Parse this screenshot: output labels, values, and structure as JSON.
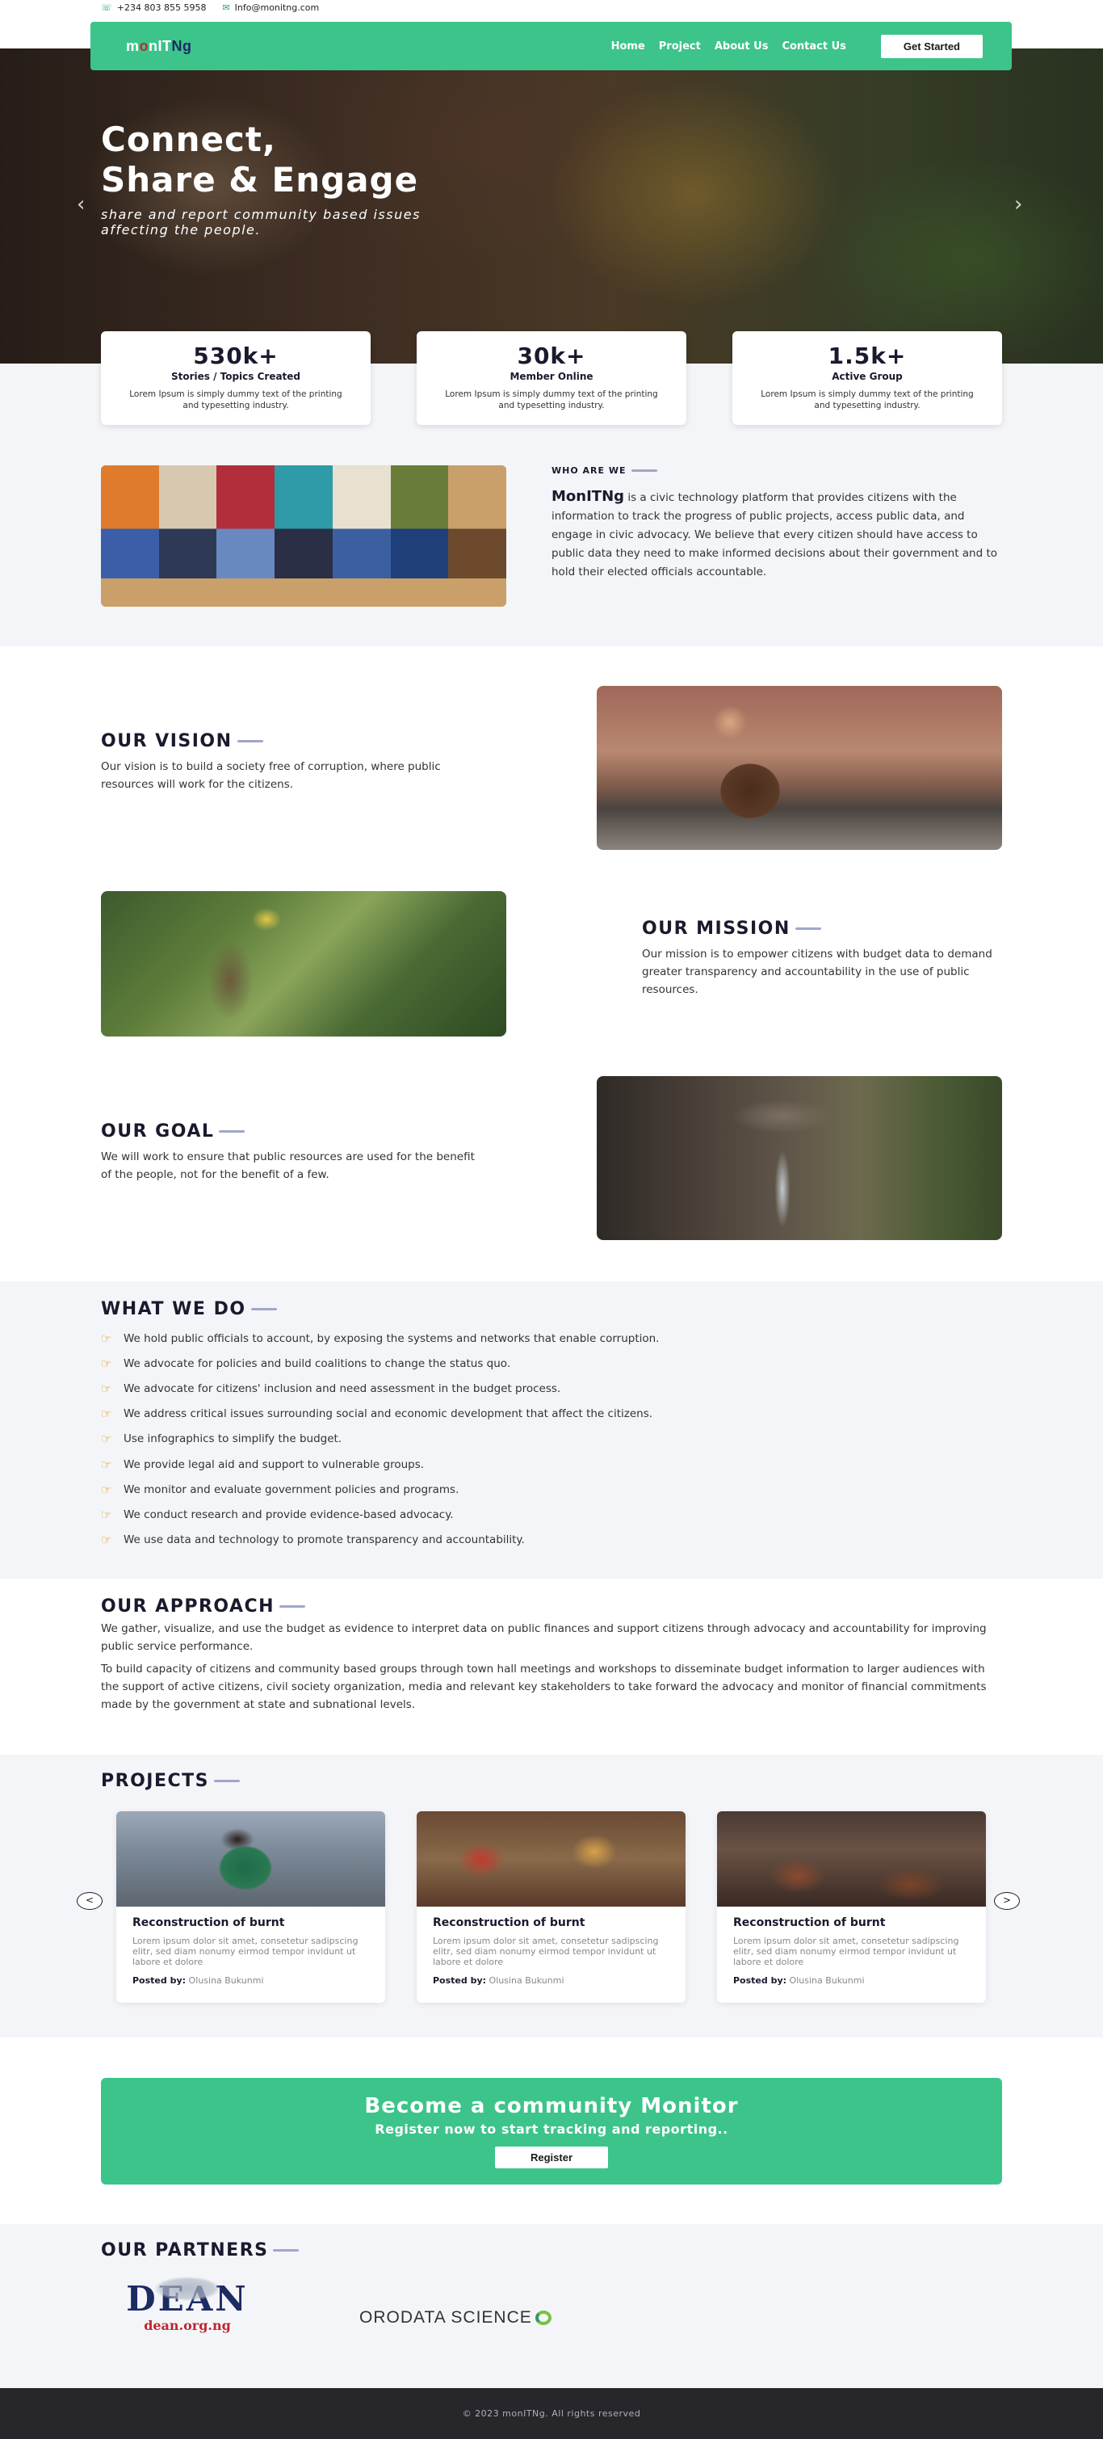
{
  "topbar": {
    "phone": "+234 803 855 5958",
    "email": "Info@monitng.com"
  },
  "nav": {
    "logo": {
      "m": "m",
      "o": "o",
      "nit": "nIT",
      "ng": "Ng"
    },
    "links": [
      "Home",
      "Project",
      "About Us",
      "Contact Us"
    ],
    "cta": "Get Started"
  },
  "hero": {
    "title_line1": "Connect,",
    "title_line2": "Share & Engage",
    "subtitle": "share and report community based issues affecting the people."
  },
  "stats": [
    {
      "value": "530k+",
      "label": "Stories / Topics Created",
      "desc": "Lorem Ipsum is simply dummy text of the printing and typesetting industry."
    },
    {
      "value": "30k+",
      "label": "Member Online",
      "desc": "Lorem Ipsum is simply dummy text of the printing and typesetting industry."
    },
    {
      "value": "1.5k+",
      "label": "Active Group",
      "desc": "Lorem Ipsum is simply dummy text of the printing and typesetting industry."
    }
  ],
  "who": {
    "label": "WHO ARE WE",
    "brand": "MonITNg",
    "body": " is a civic technology platform that provides citizens with the information to track the progress of public projects, access public data, and engage in civic advocacy. We believe that every citizen should have access to public data they need to make informed decisions about their government and to hold their elected officials accountable."
  },
  "vision": {
    "title": "OUR VISION",
    "text": "Our vision is to build a society free of corruption, where public resources will work for the citizens."
  },
  "mission": {
    "title": "OUR MISSION",
    "text": "Our mission is to empower citizens with budget data to demand greater transparency and accountability in the use of public resources."
  },
  "goal": {
    "title": "OUR GOAL",
    "text": "We will work to ensure that public resources are used for the benefit of the people, not for the benefit of a few."
  },
  "what_we_do": {
    "title": "WHAT WE DO",
    "items": [
      "We hold public officials to account, by exposing the systems and networks that enable corruption.",
      "We advocate for policies and build coalitions to change the status quo.",
      "We advocate for citizens' inclusion and need assessment in the budget process.",
      "We address critical issues surrounding social and economic development that affect the citizens.",
      "Use infographics to simplify the budget.",
      "We provide legal aid and support to vulnerable groups.",
      "We monitor and evaluate government policies and programs.",
      "We conduct research and provide evidence-based advocacy.",
      "We use data and technology to promote transparency and accountability."
    ]
  },
  "approach": {
    "title": "OUR APPROACH",
    "p1": "We gather, visualize, and use the budget as evidence to interpret data on public finances and support citizens through advocacy and accountability for improving public service performance.",
    "p2": "To build capacity of citizens and community based groups through town hall meetings and workshops to disseminate budget information to larger audiences with the support of active citizens, civil society organization, media and relevant key stakeholders to take forward the advocacy and monitor of financial commitments made by the government at state and subnational levels."
  },
  "projects": {
    "title": "PROJECTS",
    "prev": "<",
    "next": ">",
    "posted_by_label": "Posted by:",
    "items": [
      {
        "title": "Reconstruction of burnt",
        "desc": "Lorem ipsum dolor sit amet, consetetur sadipscing elitr, sed diam nonumy eirmod tempor invidunt ut labore et dolore",
        "author": "Olusina Bukunmi"
      },
      {
        "title": "Reconstruction of burnt",
        "desc": "Lorem ipsum dolor sit amet, consetetur sadipscing elitr, sed diam nonumy eirmod tempor invidunt ut labore et dolore",
        "author": "Olusina Bukunmi"
      },
      {
        "title": "Reconstruction of burnt",
        "desc": "Lorem ipsum dolor sit amet, consetetur sadipscing elitr, sed diam nonumy eirmod tempor invidunt ut labore et dolore",
        "author": "Olusina Bukunmi"
      }
    ]
  },
  "cta": {
    "title": "Become a community Monitor",
    "subtitle": "Register now to start tracking and reporting..",
    "button": "Register"
  },
  "partners": {
    "title": "OUR PARTNERS",
    "dean": {
      "name": "DEAN",
      "url": "dean.org.ng"
    },
    "oroda": "ORODATA SCIENCE"
  },
  "footer": {
    "copyright": "© 2023 monITNg. All rights reserved"
  },
  "colors": {
    "brand_green": "#3cc48b",
    "navy": "#1a1a2e",
    "grey_bg": "#f4f5f8",
    "footer_bg": "#27272b"
  },
  "icons": [
    "phone-icon",
    "email-icon",
    "chevron-left-icon",
    "chevron-right-icon",
    "pointing-hand-icon"
  ]
}
